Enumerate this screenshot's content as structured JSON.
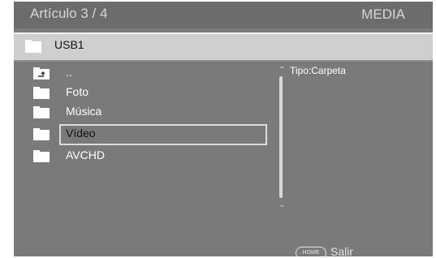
{
  "header": {
    "title": "Artículo 3 / 4",
    "mode": "MEDIA"
  },
  "path": {
    "icon": "folder-icon",
    "label": "USB1"
  },
  "list": {
    "items": [
      {
        "label": "..",
        "icon": "folder-up-icon"
      },
      {
        "label": "Foto",
        "icon": "folder-icon"
      },
      {
        "label": "Música",
        "icon": "folder-icon"
      },
      {
        "label": "Vídeo",
        "icon": "folder-icon",
        "selected": true
      },
      {
        "label": "AVCHD",
        "icon": "folder-icon"
      }
    ]
  },
  "info": {
    "text": "Tipo:Carpeta"
  },
  "footer": {
    "button_label": "HOME",
    "action_label": "Salir"
  },
  "colors": {
    "background": "#7a7a7a",
    "path_bar": "#cfcfcf",
    "text": "#ffffff"
  }
}
